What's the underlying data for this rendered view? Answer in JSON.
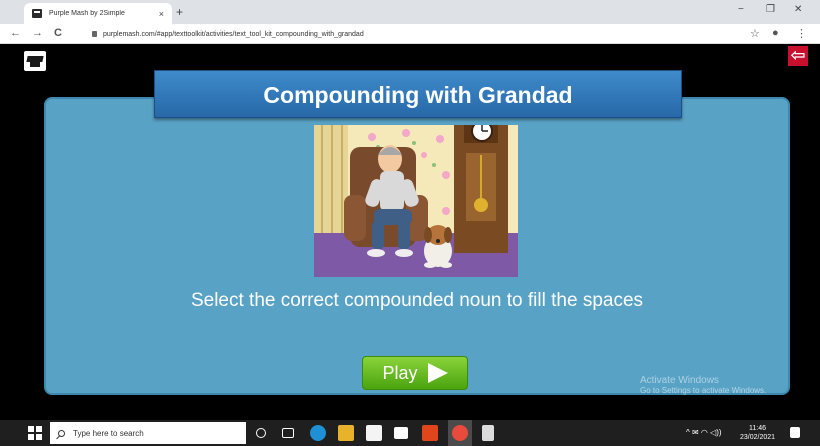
{
  "browser": {
    "tab_title": "Purple Mash by 2Simple",
    "tab_close": "×",
    "new_tab": "+",
    "window_minimize": "−",
    "window_restore": "❐",
    "window_close": "✕",
    "url": "purplemash.com/#app/texttoolkit/activities/text_tool_kit_compounding_with_grandad",
    "back": "←",
    "forward": "→",
    "reload": "C",
    "star": "☆",
    "account": "●",
    "menu": "⋮"
  },
  "app": {
    "back_arrow": "⇦",
    "banner_title": "Compounding with Grandad",
    "instruction": "Select the correct compounded noun to fill the spaces",
    "play_label": "Play",
    "watermark_line1": "Activate Windows",
    "watermark_line2": "Go to Settings to activate Windows."
  },
  "taskbar": {
    "search_placeholder": "Type here to search",
    "tray_text": "^ ✉ ◠ ◁))",
    "time": "11:46",
    "date": "23/02/2021"
  },
  "colors": {
    "panel": "#58a2c6",
    "banner": "#2f78b8",
    "play": "#6cc11f",
    "back_red": "#c8102e"
  }
}
